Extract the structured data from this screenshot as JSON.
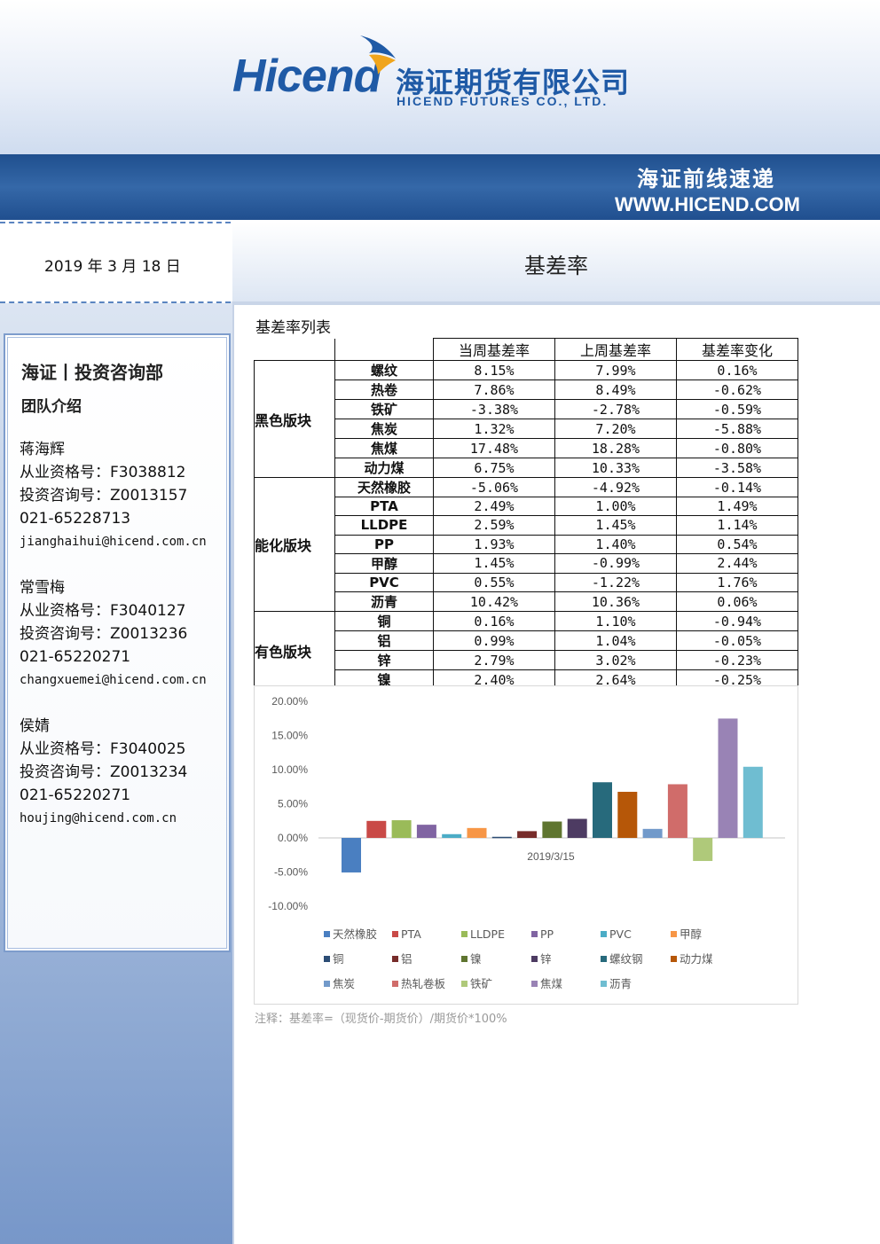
{
  "header": {
    "logo_en": "Hicend",
    "logo_cn": "海证期货有限公司",
    "logo_sub": "HICEND  FUTURES  CO.,  LTD.",
    "brand_color": "#1f5aa6"
  },
  "banner": {
    "title": "海证前线速递",
    "url": "WWW.HICEND.COM"
  },
  "date": "2019 年 3 月 18 日",
  "page_title": "基差率",
  "sidebar": {
    "dept": "海证丨投资咨询部",
    "team_intro": "团队介绍",
    "members": [
      {
        "name": "蒋海辉",
        "qual": "从业资格号：F3038812",
        "consult": "投资咨询号：Z0013157",
        "phone": "021-65228713",
        "email": "jianghaihui@hicend.com.cn"
      },
      {
        "name": "常雪梅",
        "qual": "从业资格号：F3040127",
        "consult": "投资咨询号：Z0013236",
        "phone": "021-65220271",
        "email": "changxuemei@hicend.com.cn"
      },
      {
        "name": "侯婧",
        "qual": "从业资格号：F3040025",
        "consult": "投资咨询号：Z0013234",
        "phone": "021-65220271",
        "email": "houjing@hicend.com.cn"
      }
    ]
  },
  "table": {
    "caption": "基差率列表",
    "headers": [
      "当周基差率",
      "上周基差率",
      "基差率变化"
    ],
    "groups": [
      {
        "sector": "黑色版块",
        "rows": [
          {
            "product": "螺纹",
            "cur": "8.15%",
            "prev": "7.99%",
            "chg": "0.16%"
          },
          {
            "product": "热卷",
            "cur": "7.86%",
            "prev": "8.49%",
            "chg": "-0.62%"
          },
          {
            "product": "铁矿",
            "cur": "-3.38%",
            "prev": "-2.78%",
            "chg": "-0.59%"
          },
          {
            "product": "焦炭",
            "cur": "1.32%",
            "prev": "7.20%",
            "chg": "-5.88%"
          },
          {
            "product": "焦煤",
            "cur": "17.48%",
            "prev": "18.28%",
            "chg": "-0.80%"
          },
          {
            "product": "动力煤",
            "cur": "6.75%",
            "prev": "10.33%",
            "chg": "-3.58%"
          }
        ]
      },
      {
        "sector": "能化版块",
        "rows": [
          {
            "product": "天然橡胶",
            "cur": "-5.06%",
            "prev": "-4.92%",
            "chg": "-0.14%"
          },
          {
            "product": "PTA",
            "cur": "2.49%",
            "prev": "1.00%",
            "chg": "1.49%"
          },
          {
            "product": "LLDPE",
            "cur": "2.59%",
            "prev": "1.45%",
            "chg": "1.14%"
          },
          {
            "product": "PP",
            "cur": "1.93%",
            "prev": "1.40%",
            "chg": "0.54%"
          },
          {
            "product": "甲醇",
            "cur": "1.45%",
            "prev": "-0.99%",
            "chg": "2.44%"
          },
          {
            "product": "PVC",
            "cur": "0.55%",
            "prev": "-1.22%",
            "chg": "1.76%"
          },
          {
            "product": "沥青",
            "cur": "10.42%",
            "prev": "10.36%",
            "chg": "0.06%"
          }
        ]
      },
      {
        "sector": "有色版块",
        "rows": [
          {
            "product": "铜",
            "cur": "0.16%",
            "prev": "1.10%",
            "chg": "-0.94%"
          },
          {
            "product": "铝",
            "cur": "0.99%",
            "prev": "1.04%",
            "chg": "-0.05%"
          },
          {
            "product": "锌",
            "cur": "2.79%",
            "prev": "3.02%",
            "chg": "-0.23%"
          },
          {
            "product": "镍",
            "cur": "2.40%",
            "prev": "2.64%",
            "chg": "-0.25%"
          }
        ]
      }
    ]
  },
  "chart_data": {
    "type": "bar",
    "categories": [
      "2019/3/15"
    ],
    "ylim": [
      -0.1,
      0.2
    ],
    "yticks": [
      -0.1,
      -0.05,
      0.0,
      0.05,
      0.1,
      0.15,
      0.2
    ],
    "ytick_labels": [
      "-10.00%",
      "-5.00%",
      "0.00%",
      "5.00%",
      "10.00%",
      "15.00%",
      "20.00%"
    ],
    "grid": false,
    "legend_position": "bottom",
    "series": [
      {
        "name": "天然橡胶",
        "values": [
          -0.0506
        ],
        "color": "#4a7fc1"
      },
      {
        "name": "PTA",
        "values": [
          0.0249
        ],
        "color": "#c94a47"
      },
      {
        "name": "LLDPE",
        "values": [
          0.0259
        ],
        "color": "#9abb59"
      },
      {
        "name": "PP",
        "values": [
          0.0193
        ],
        "color": "#8064a2"
      },
      {
        "name": "PVC",
        "values": [
          0.0055
        ],
        "color": "#4bacc6"
      },
      {
        "name": "甲醇",
        "values": [
          0.0145
        ],
        "color": "#f79646"
      },
      {
        "name": "铜",
        "values": [
          0.0016
        ],
        "color": "#2c4d75"
      },
      {
        "name": "铝",
        "values": [
          0.0099
        ],
        "color": "#772c2a"
      },
      {
        "name": "镍",
        "values": [
          0.024
        ],
        "color": "#5f7530"
      },
      {
        "name": "锌",
        "values": [
          0.0279
        ],
        "color": "#4d3b62"
      },
      {
        "name": "螺纹钢",
        "values": [
          0.0815
        ],
        "color": "#276a7c"
      },
      {
        "name": "动力煤",
        "values": [
          0.0675
        ],
        "color": "#b65708"
      },
      {
        "name": "焦炭",
        "values": [
          0.0132
        ],
        "color": "#729aca"
      },
      {
        "name": "热轧卷板",
        "values": [
          0.0786
        ],
        "color": "#d06c6a"
      },
      {
        "name": "铁矿",
        "values": [
          -0.0338
        ],
        "color": "#afc97a"
      },
      {
        "name": "焦煤",
        "values": [
          0.1748
        ],
        "color": "#9983b5"
      },
      {
        "name": "沥青",
        "values": [
          0.1042
        ],
        "color": "#6fbdd1"
      }
    ]
  },
  "note": "注释：基差率=（现货价-期货价）/期货价*100%"
}
